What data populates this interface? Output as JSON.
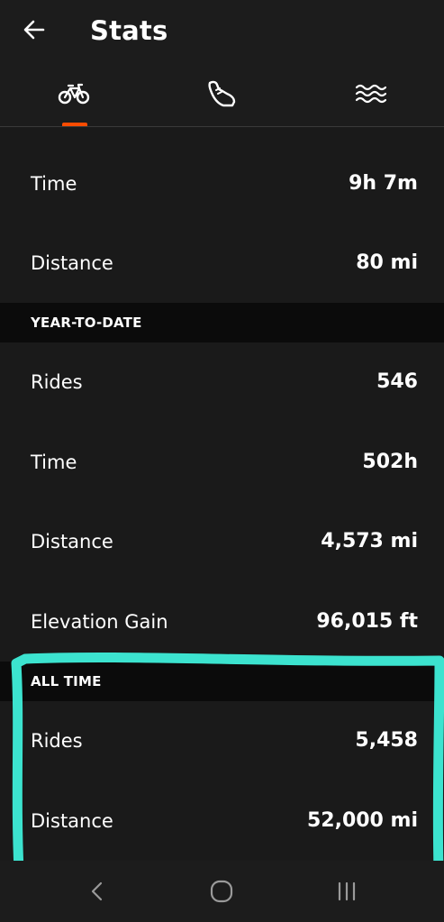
{
  "header": {
    "title": "Stats",
    "back_icon": "arrow-left-icon"
  },
  "tabs": [
    {
      "icon": "bike-icon",
      "selected": true
    },
    {
      "icon": "shoe-icon",
      "selected": false
    },
    {
      "icon": "water-icon",
      "selected": false
    }
  ],
  "accent_color": "#fc4c02",
  "highlight_color": "#3ce3cf",
  "recent": {
    "rows": [
      {
        "label": "Time",
        "value": "9h 7m"
      },
      {
        "label": "Distance",
        "value": "80 mi"
      }
    ]
  },
  "ytd": {
    "header": "YEAR-TO-DATE",
    "rows": [
      {
        "label": "Rides",
        "value": "546"
      },
      {
        "label": "Time",
        "value": "502h"
      },
      {
        "label": "Distance",
        "value": "4,573 mi"
      },
      {
        "label": "Elevation Gain",
        "value": "96,015 ft"
      }
    ]
  },
  "all_time": {
    "header": "ALL TIME",
    "rows": [
      {
        "label": "Rides",
        "value": "5,458"
      },
      {
        "label": "Distance",
        "value": "52,000 mi"
      }
    ]
  },
  "system_nav": {
    "back_icon": "nav-back-icon",
    "home_icon": "nav-home-icon",
    "recents_icon": "nav-recents-icon"
  }
}
